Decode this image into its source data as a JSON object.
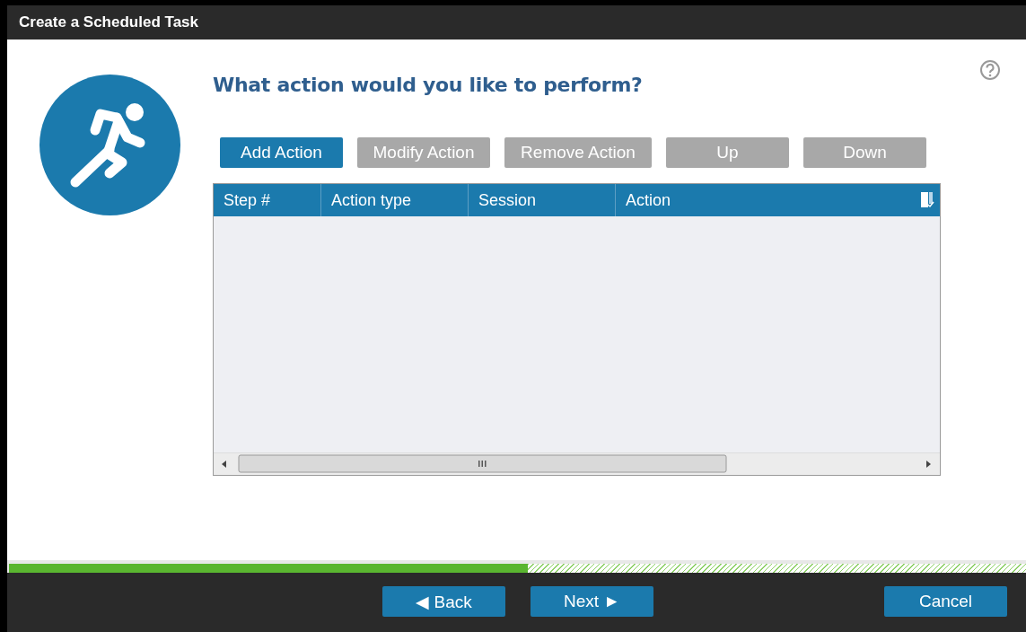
{
  "window": {
    "title": "Create a Scheduled Task"
  },
  "heading": "What action would you like to perform?",
  "toolbar": [
    {
      "label": "Add Action",
      "disabled": false
    },
    {
      "label": "Modify Action",
      "disabled": true
    },
    {
      "label": "Remove Action",
      "disabled": true
    },
    {
      "label": "Up",
      "disabled": true
    },
    {
      "label": "Down",
      "disabled": true
    }
  ],
  "table": {
    "columns": [
      "Step #",
      "Action type",
      "Session",
      "Action"
    ]
  },
  "progress": {
    "level": 0.51
  },
  "footer": {
    "buttons": [
      {
        "label": "◀ Back",
        "kind": "nav"
      },
      {
        "label": "Next ►",
        "kind": "nav"
      },
      {
        "label": "Cancel",
        "kind": "cancel"
      }
    ]
  }
}
